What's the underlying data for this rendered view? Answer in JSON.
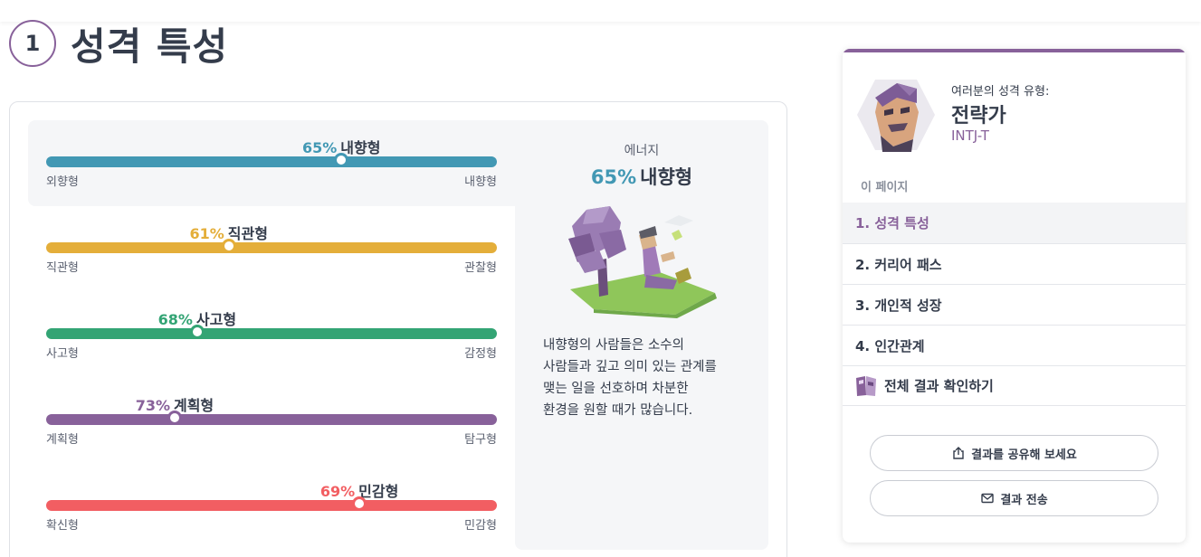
{
  "section": {
    "number": "1",
    "title": "성격 특성"
  },
  "traits": [
    {
      "percent": "65%",
      "name": "내향형",
      "value": 65,
      "color": "#4298b4",
      "left_label": "외향형",
      "right_label": "내향형",
      "position": 0.655
    },
    {
      "percent": "61%",
      "name": "직관형",
      "value": 61,
      "color": "#e4ae3a",
      "left_label": "직관형",
      "right_label": "관찰형",
      "position": 0.405
    },
    {
      "percent": "68%",
      "name": "사고형",
      "value": 68,
      "color": "#33a474",
      "left_label": "사고형",
      "right_label": "감정형",
      "position": 0.335
    },
    {
      "percent": "73%",
      "name": "계획형",
      "value": 73,
      "color": "#88619a",
      "left_label": "계획형",
      "right_label": "탐구형",
      "position": 0.285
    },
    {
      "percent": "69%",
      "name": "민감형",
      "value": 69,
      "color": "#f25e62",
      "left_label": "확신형",
      "right_label": "민감형",
      "position": 0.695
    }
  ],
  "detail": {
    "caption": "에너지",
    "percent": "65%",
    "name": "내향형",
    "lines": [
      "내향형의 사람들은 소수의",
      "사람들과 깊고 의미 있는 관계를",
      "맺는 일을 선호하며 차분한",
      "환경을 원할 때가 많습니다."
    ]
  },
  "sidebar": {
    "type_caption": "여러분의 성격 유형:",
    "type_name": "전략가",
    "type_code": "INTJ-T",
    "page_heading": "이 페이지",
    "items": [
      {
        "label": "1. 성격 특성"
      },
      {
        "label": "2. 커리어 패스"
      },
      {
        "label": "3. 개인적 성장"
      },
      {
        "label": "4. 인간관계"
      },
      {
        "label": "전체 결과 확인하기"
      }
    ],
    "share_label": "결과를 공유해 보세요",
    "email_label": "결과 전송"
  },
  "colors": {
    "accent": "#88619a",
    "energy": "#4298b4",
    "mind": "#e4ae3a",
    "nature": "#33a474",
    "tactics": "#88619a",
    "identity": "#f25e62"
  },
  "icons": {
    "share": "share-icon",
    "email": "envelope-icon",
    "results": "results-book-icon"
  }
}
